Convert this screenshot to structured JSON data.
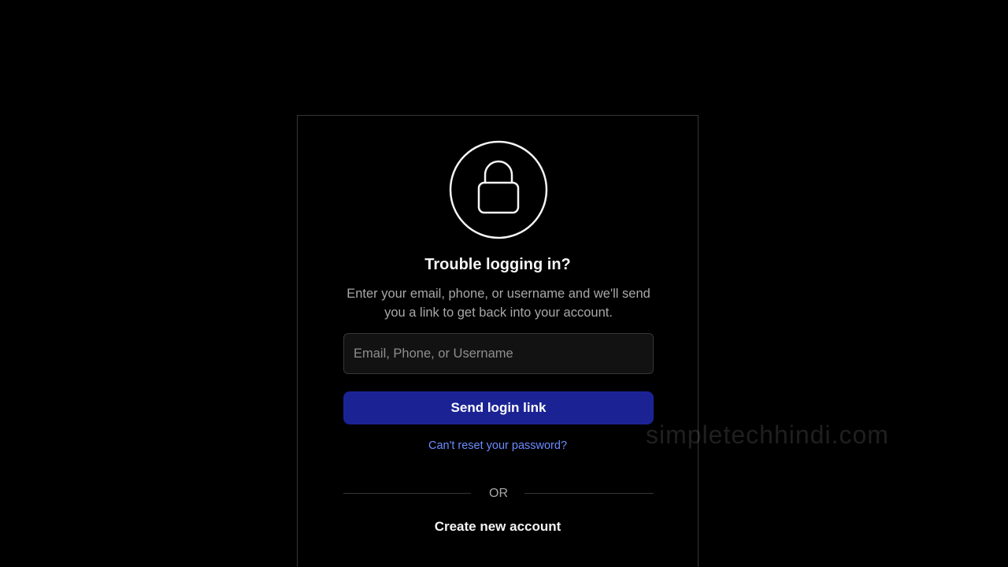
{
  "reset_form": {
    "lock_icon": "lock-icon",
    "title": "Trouble logging in?",
    "description": "Enter your email, phone, or username and we'll send you a link to get back into your account.",
    "input": {
      "value": "",
      "placeholder": "Email, Phone, or Username"
    },
    "send_button_label": "Send login link",
    "reset_link_label": "Can't reset your password?",
    "divider_label": "OR",
    "create_account_label": "Create new account"
  },
  "watermark": "simpletechhindi.com",
  "colors": {
    "background": "#000000",
    "button": "#1b2394",
    "link": "#6c8cff",
    "border": "#363636"
  }
}
